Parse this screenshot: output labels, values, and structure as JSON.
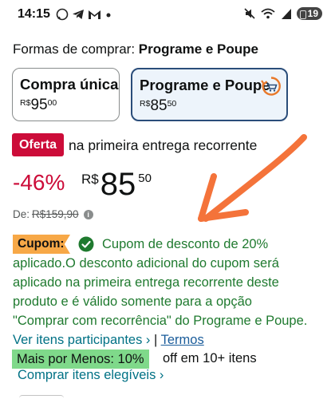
{
  "status_bar": {
    "time": "14:15",
    "left_icons": [
      "whatsapp-icon",
      "telegram-icon",
      "gmail-icon",
      "dot-icon"
    ],
    "right_icons": [
      "mute-icon",
      "wifi-icon",
      "signal-icon"
    ],
    "battery": "19"
  },
  "ways_to_buy": {
    "label": "Formas de comprar:",
    "selected": "Programe e Poupe"
  },
  "options": [
    {
      "title": "Compra única",
      "currency": "R$",
      "price_int": "95",
      "price_cents": "00",
      "selected": false
    },
    {
      "title": "Programe e Poupe",
      "currency": "R$",
      "price_int": "85",
      "price_cents": "50",
      "selected": true,
      "icon": "subscribe-save-icon"
    }
  ],
  "offer": {
    "badge": "Oferta",
    "text": "na primeira entrega recorrente"
  },
  "price": {
    "discount": "-46%",
    "currency": "R$",
    "integer": "85",
    "cents": "50",
    "list_label": "De:",
    "list_price": "R$159,90"
  },
  "coupon": {
    "badge": "Cupom:",
    "message": "Cupom de desconto de 20% aplicado.O desconto adicional do cupom será aplicado na primeira entrega recorrente deste produto e é válido somente para a opção \"Comprar com recorrência\" do Programe e Poupe.",
    "link": "Ver itens participantes",
    "separator": "|",
    "terms": "Termos"
  },
  "more_for_less": {
    "badge": "Mais por Menos: 10%",
    "text": "off em 10+ itens",
    "link": "Comprar itens elegíveis"
  },
  "colors": {
    "deal_red": "#cc0c39",
    "coupon_orange": "#f7a847",
    "coupon_green": "#1f7a2f",
    "link_teal": "#007185",
    "selected_border": "#2a4d7a",
    "annotation_arrow": "#f4733a",
    "more_for_less_green": "#7fd98a"
  }
}
